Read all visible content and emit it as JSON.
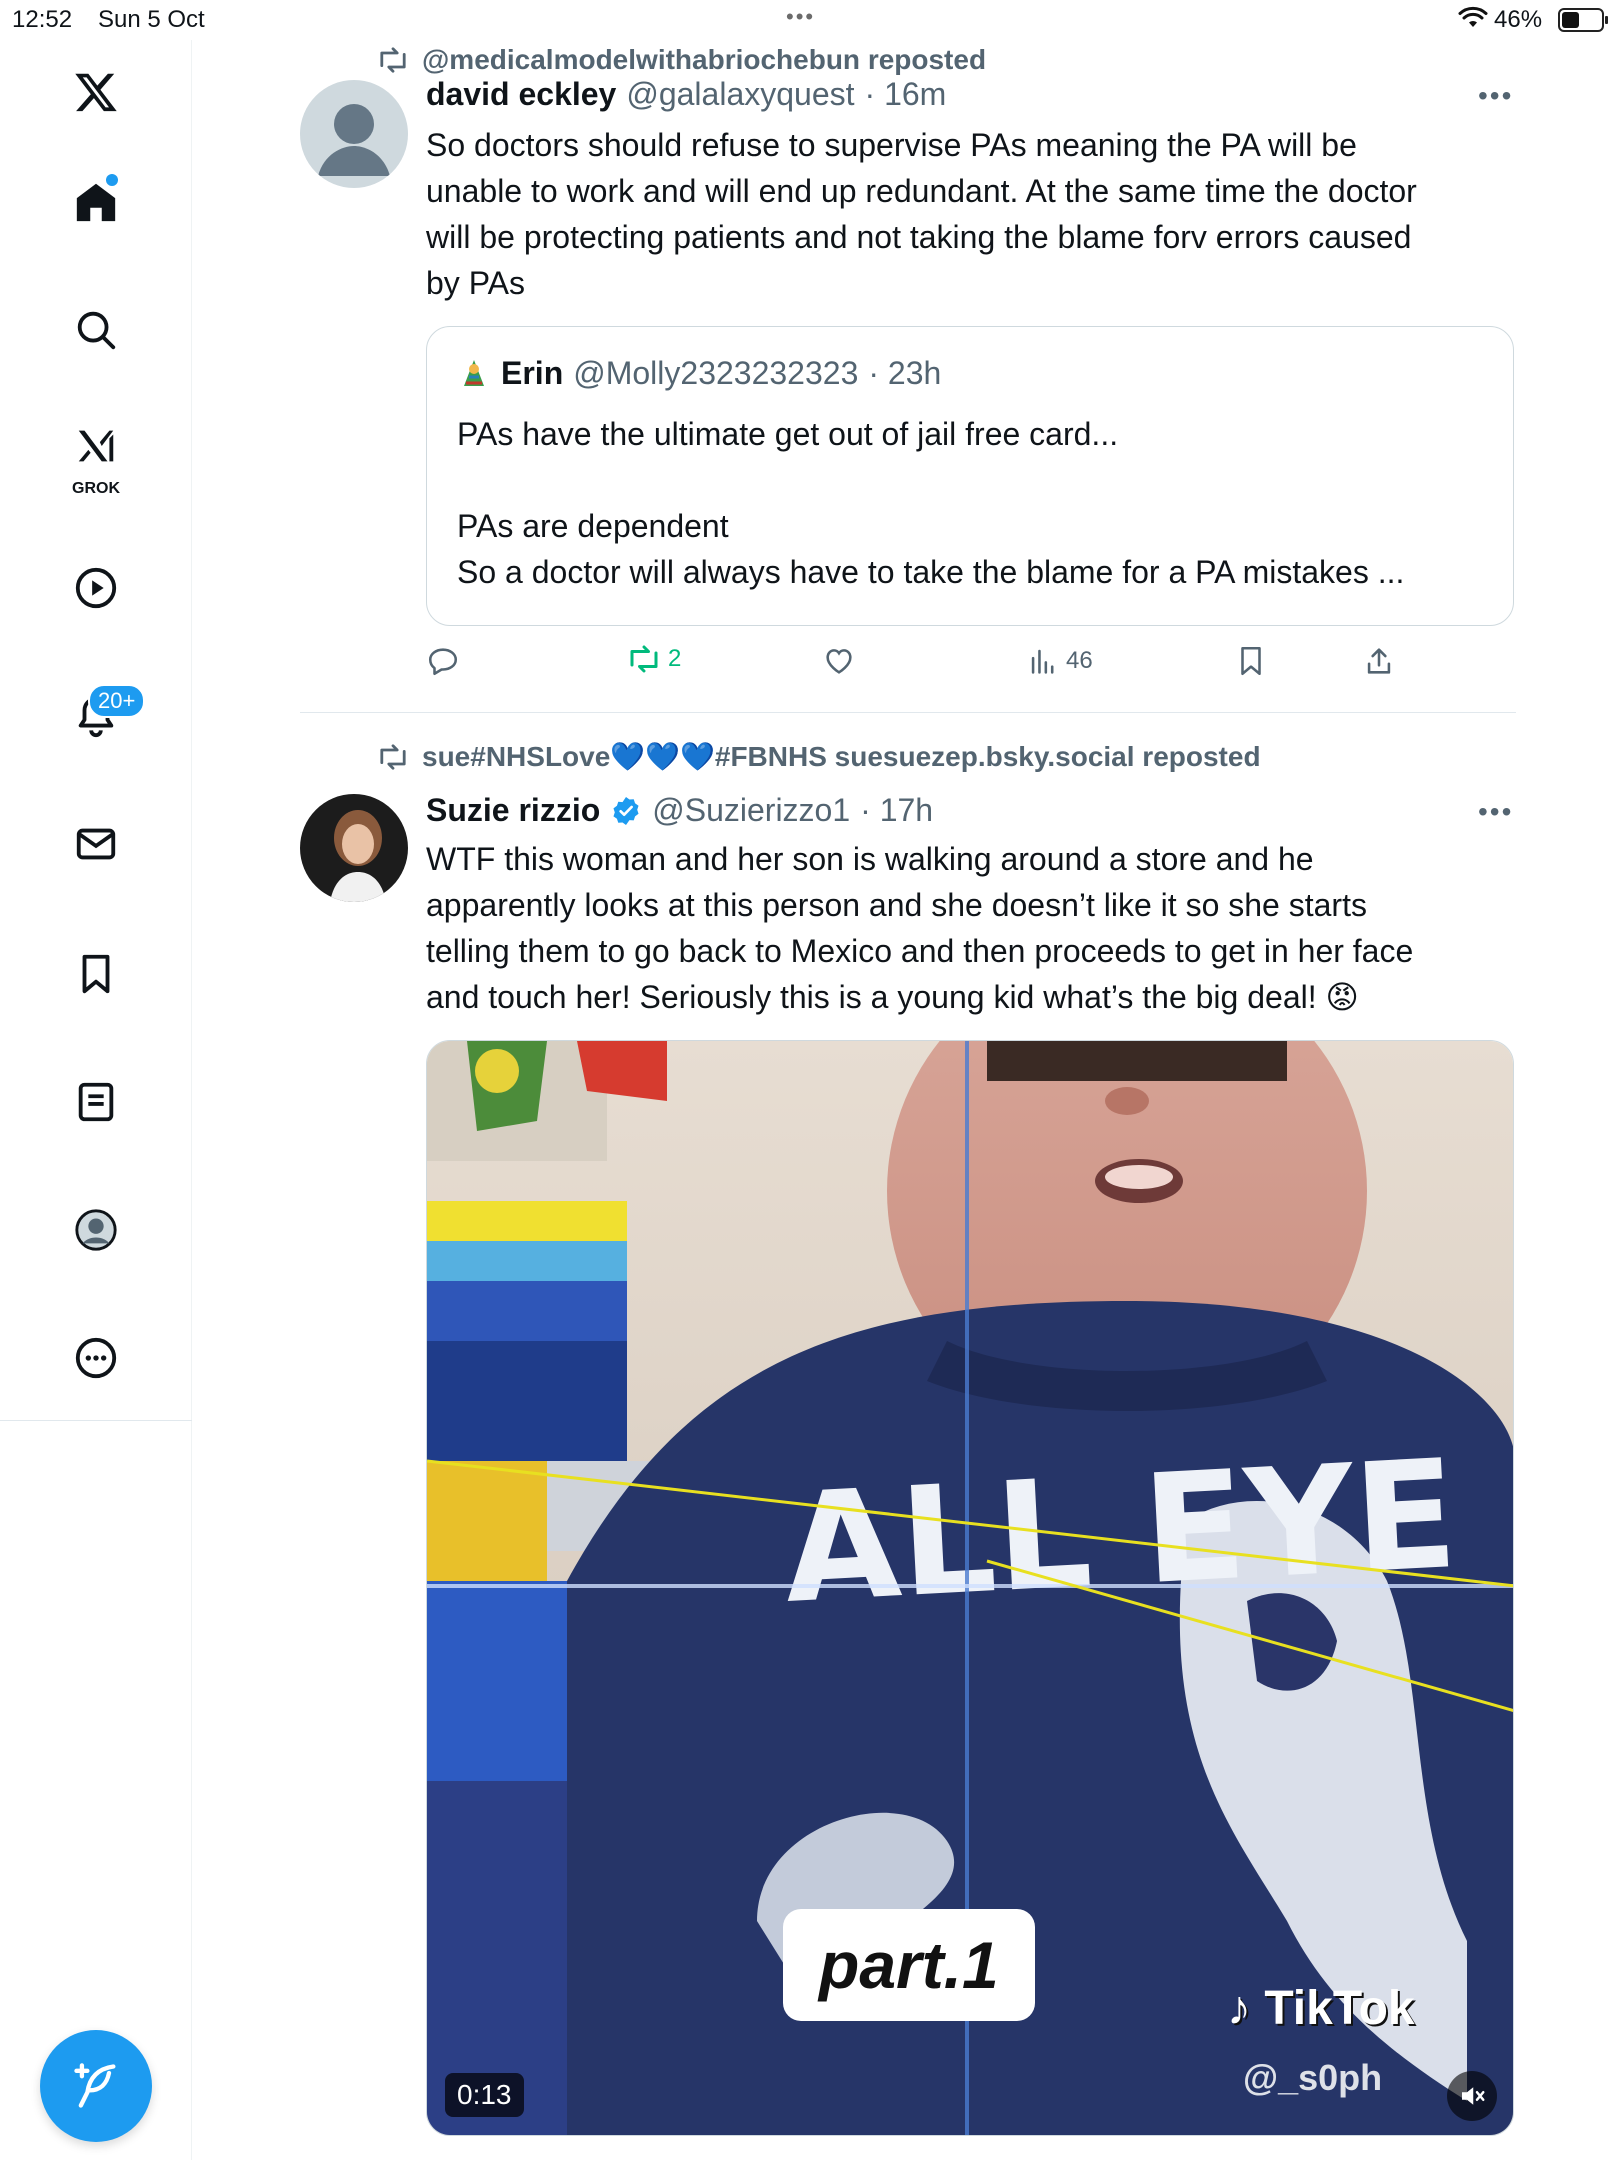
{
  "status_bar": {
    "time": "12:52",
    "date": "Sun 5 Oct",
    "battery": "46%",
    "battery_level": 0.46,
    "more": "•••"
  },
  "sidebar": {
    "grok_label": "GROK",
    "notifications_badge": "20+",
    "accent": "#1d9bf0"
  },
  "posts": [
    {
      "reposted_by": "@medicalmodelwithabriochebun reposted",
      "name": "david eckley",
      "handle": "@galalaxyquest",
      "time": "· 16m",
      "text": "So doctors should refuse to supervise PAs meaning the PA will be\nunable to work and will end up redundant. At the same time the doctor\nwill be protecting patients and not taking the blame forv errors caused\nby PAs",
      "quote": {
        "name": "Erin",
        "handle": "@Molly2323232323",
        "time": "· 23h",
        "text": "PAs have the ultimate get out of jail free card...\n\nPAs are dependent\nSo a doctor will always have to take the blame for a PA mistakes ..."
      },
      "actions": {
        "reposts": "2",
        "views": "46"
      }
    },
    {
      "reposted_by": "sue#NHSLove💙💙💙#FBNHS suesuezep.bsky.social reposted",
      "name": "Suzie rizzio",
      "handle": "@Suzierizzo1",
      "time": "· 17h",
      "text": "WTF this woman and her son is walking around a store and he\napparently looks at this person and she doesn’t like it so she starts\ntelling them to go back to Mexico and then proceeds to get in her face\nand touch her! Seriously this is a young kid what’s the big deal! 😡",
      "video": {
        "duration": "0:13",
        "overlay_text": "part.1",
        "shirt_text": "ALL EYE",
        "watermark": "TikTok",
        "watermark_handle": "@_s0ph"
      }
    }
  ]
}
